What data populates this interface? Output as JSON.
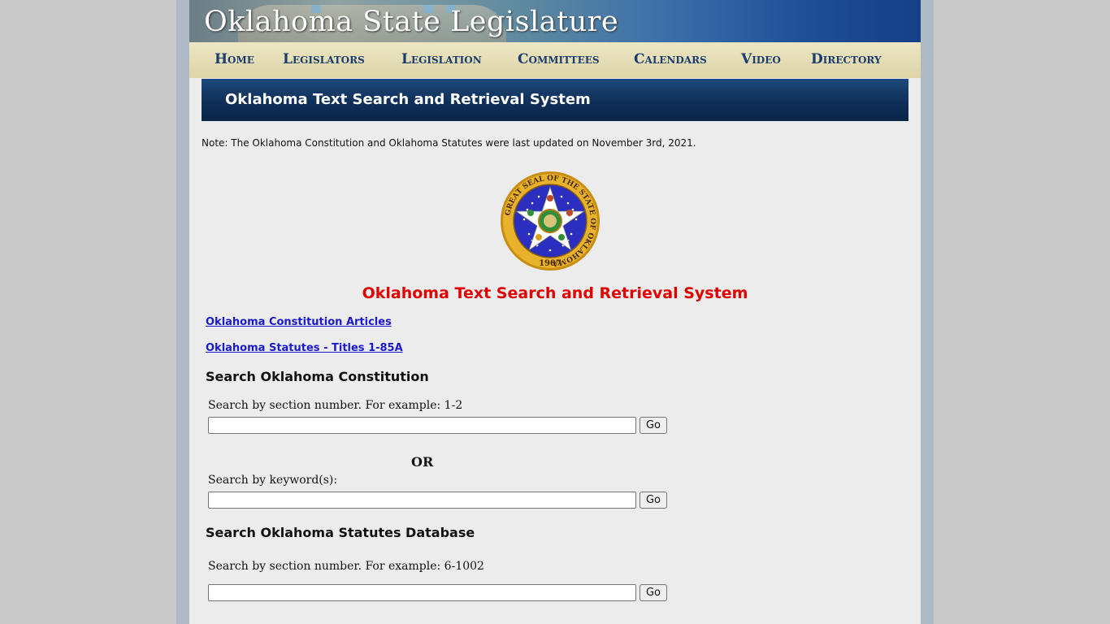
{
  "header": {
    "site_title": "Oklahoma State Legislature"
  },
  "nav": {
    "items": [
      "Home",
      "Legislators",
      "Legislation",
      "Committees",
      "Calendars",
      "Video",
      "Directory"
    ]
  },
  "subheader": {
    "title": "Oklahoma Text Search and Retrieval System"
  },
  "note": "Note: The Oklahoma Constitution and Oklahoma Statutes were last updated on November 3rd, 2021.",
  "seal": {
    "text_ring": "GREAT SEAL OF THE STATE OF OKLAHOMA",
    "year": "1907",
    "colors": {
      "ring": "#d8a21c",
      "field": "#2a2fbf",
      "star": "#ffffff"
    }
  },
  "main_title": "Oklahoma Text Search and Retrieval System",
  "links": {
    "constitution": "Oklahoma Constitution Articles",
    "statutes": "Oklahoma Statutes - Titles 1-85A"
  },
  "constitution_search": {
    "heading": "Search Oklahoma Constitution",
    "section_label": "Search by section number.  For example: 1-2",
    "section_value": "",
    "or_label": "OR",
    "keyword_label": "Search by keyword(s):",
    "keyword_value": "",
    "go_label": "Go"
  },
  "statutes_search": {
    "heading": "Search Oklahoma Statutes Database",
    "section_label": "Search by section number.  For example: 6-1002",
    "section_value": "",
    "go_label": "Go"
  }
}
